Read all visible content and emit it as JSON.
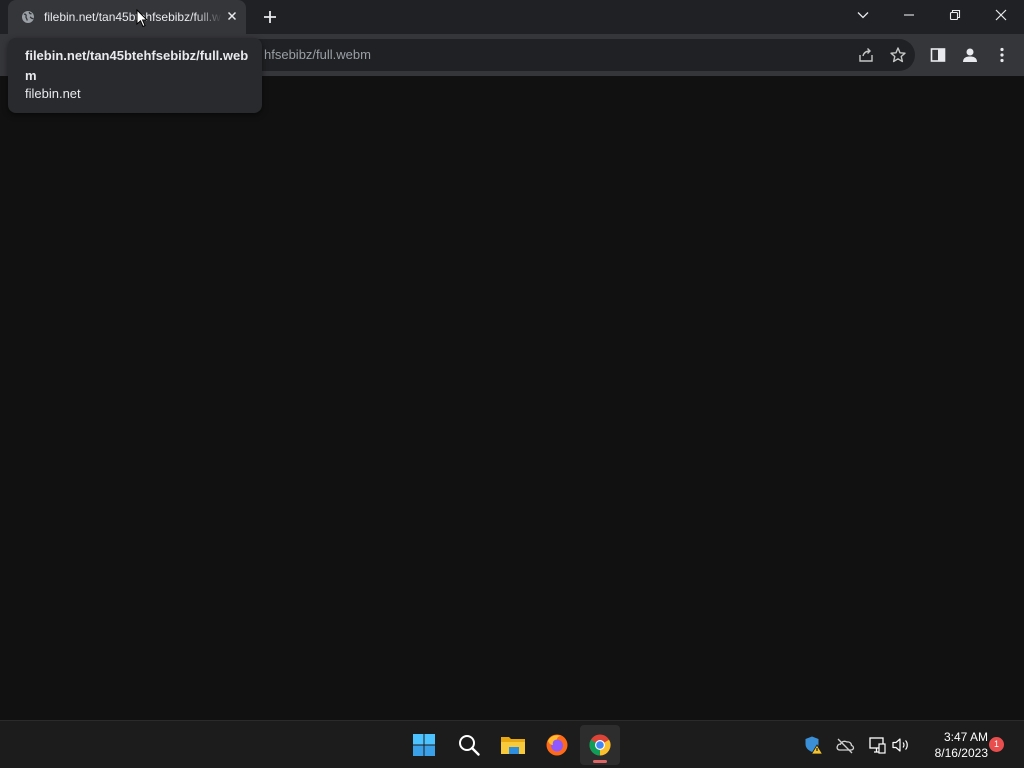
{
  "browser": {
    "tab": {
      "title": "filebin.net/tan45btehfsebibz/full.webm",
      "favicon": "globe-icon",
      "close": "close-icon"
    },
    "new_tab": "plus-icon",
    "window_controls": [
      "tab-search-chevron-icon",
      "minimize-icon",
      "restore-icon",
      "close-icon"
    ],
    "omnibox": {
      "visible_text": "hfsebibz/full.webm"
    },
    "toolbar_icons": [
      "share-icon",
      "star-icon",
      "side-panel-icon",
      "profile-icon",
      "kebab-menu-icon"
    ],
    "hovercard": {
      "title": "filebin.net/tan45btehfsebibz/full.webm",
      "domain": "filebin.net"
    }
  },
  "taskbar": {
    "apps": [
      "windows-start-icon",
      "search-icon",
      "file-explorer-icon",
      "firefox-icon",
      "chrome-icon"
    ],
    "active_app": "chrome-icon",
    "tray": [
      "windows-security-warning-icon",
      "onedrive-offline-icon",
      "network-icon",
      "volume-icon"
    ],
    "time": "3:47 AM",
    "date": "8/16/2023",
    "notification_count": "1"
  },
  "colors": {
    "titlebar": "#202124",
    "tab_active": "#35363a",
    "toolbar": "#35363a",
    "omnibox": "#202124",
    "content": "#111111",
    "taskbar": "#1c1c1c",
    "notification_badge": "#e84e4e"
  }
}
